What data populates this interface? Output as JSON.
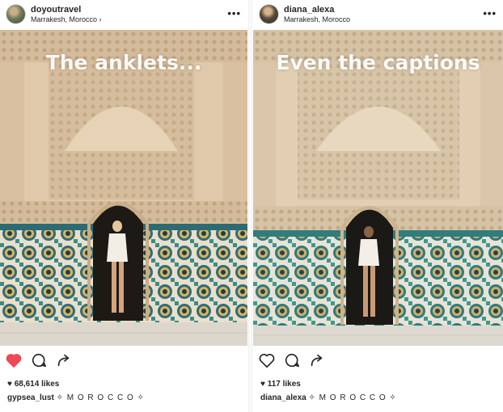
{
  "left_post": {
    "username": "doyoutravel",
    "location": "Marrakesh, Morocco",
    "location_chevron": "›",
    "more": "•••",
    "overlay_text": "The anklets...",
    "liked": true,
    "likes": "68,614 likes",
    "caption_user": "gypsea_lust",
    "caption_text": "✧ M O R O C C O ✧"
  },
  "right_post": {
    "username": "diana_alexa",
    "location": "Marrakesh, Morocco",
    "more": "•••",
    "overlay_text": "Even the captions",
    "liked": false,
    "likes": "117 likes",
    "caption_user": "diana_alexa",
    "caption_text": "✧ M O R O C C O ✧"
  },
  "icons": {
    "like": "heart-icon",
    "comment": "comment-icon",
    "share": "share-icon",
    "more": "more-options-icon"
  },
  "colors": {
    "like_active": "#ed4956",
    "text": "#262626"
  }
}
